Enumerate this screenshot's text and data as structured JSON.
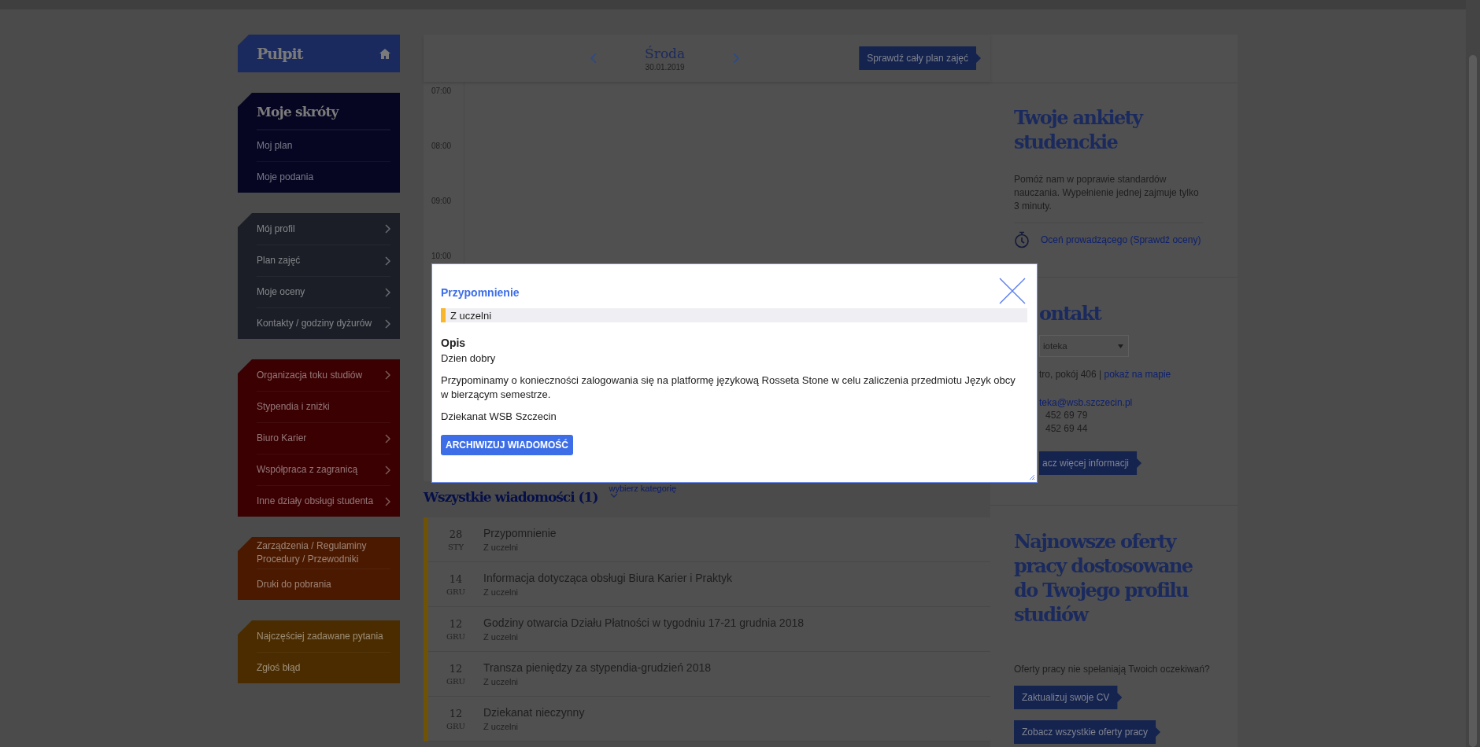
{
  "sidebar": {
    "home": {
      "label": "Pulpit"
    },
    "groups": [
      {
        "kind": "titled",
        "title": "Moje skróty",
        "color": "#060622",
        "items": [
          {
            "label": "Moj plan",
            "submenu": false
          },
          {
            "label": "Moje podania",
            "submenu": false
          }
        ]
      },
      {
        "kind": "plain",
        "color": "#1b1e26",
        "items": [
          {
            "label": "Mój profil",
            "submenu": true
          },
          {
            "label": "Plan zajęć",
            "submenu": true
          },
          {
            "label": "Moje oceny",
            "submenu": true
          },
          {
            "label": "Kontakty / godziny dyżurów",
            "submenu": true
          }
        ]
      },
      {
        "kind": "plain",
        "color": "#3a0002",
        "items": [
          {
            "label": "Organizacja toku studiów",
            "submenu": true
          },
          {
            "label": "Stypendia i zniżki",
            "submenu": false
          },
          {
            "label": "Biuro Karier",
            "submenu": true
          },
          {
            "label": "Współpraca z zagranicą",
            "submenu": true
          },
          {
            "label": "Inne działy obsługi studenta",
            "submenu": true
          }
        ]
      },
      {
        "kind": "plain",
        "color": "#4a1900",
        "items": [
          {
            "label": "Zarządzenia / Regulaminy Procedury / Przewodniki",
            "submenu": false
          },
          {
            "label": "Druki do pobrania",
            "submenu": false
          }
        ]
      },
      {
        "kind": "plain",
        "color": "#4a2c00",
        "items": [
          {
            "label": "Najczęściej zadawane pytania",
            "submenu": false
          },
          {
            "label": "Zgłoś błąd",
            "submenu": false
          }
        ]
      }
    ]
  },
  "calendar": {
    "day": "Środa",
    "date": "30.01.2019",
    "button": "Sprawdź cały plan zajęć",
    "hours": [
      "07:00",
      "08:00",
      "09:00",
      "10:00"
    ]
  },
  "messages": {
    "title": "Wszystkie wiadomości (1)",
    "filter": "wybierz kategorię",
    "items": [
      {
        "day": "28",
        "month": "STY",
        "title": "Przypomnienie",
        "category": "Z uczelni"
      },
      {
        "day": "14",
        "month": "GRU",
        "title": "Informacja dotycząca obsługi Biura Karier i Praktyk",
        "category": "Z uczelni"
      },
      {
        "day": "12",
        "month": "GRU",
        "title": "Godziny otwarcia Działu Płatności w tygodniu 17-21 grudnia 2018",
        "category": "Z uczelni"
      },
      {
        "day": "12",
        "month": "GRU",
        "title": "Transza pieniędzy za stypendia-grudzień 2018",
        "category": "Z uczelni"
      },
      {
        "day": "12",
        "month": "GRU",
        "title": "Dziekanat nieczynny",
        "category": "Z uczelni"
      }
    ]
  },
  "survey": {
    "title": "Twoje ankiety studenckie",
    "text": "Pomóż nam w poprawie standardów nauczania. Wypełnienie jednej zajmuje tylko 3 minuty.",
    "link": "Oceń prowadzącego (Sprawdź oceny)"
  },
  "contact": {
    "title": "ontakt",
    "select": "ioteka",
    "address": "tro, pokój 406 |",
    "map_link": "pokaż na mapie",
    "email": "teka@wsb.szczecin.pl",
    "phones": [
      "452 69 79",
      "452 69 44"
    ],
    "button": "acz więcej informacji"
  },
  "jobs": {
    "title": "Najnowsze oferty pracy dostosowane do Twojego profilu studiów",
    "text": "Oferty pracy nie spełaniają Twoich oczekiwań?",
    "buttons": [
      "Zaktualizuj swoje CV",
      "Zobacz wszystkie oferty pracy"
    ]
  },
  "modal": {
    "title": "Przypomnienie",
    "category": "Z uczelni",
    "section": "Opis",
    "paragraphs": [
      "Dzien dobry",
      "Przypominamy o konieczności zalogowania się na platformę językową  Rosseta Stone w celu zaliczenia przedmiotu Język obcy w bierzącym semestrze.",
      "Dziekanat WSB Szczecin"
    ],
    "button": "ARCHIWIZUJ WIADOMOŚĆ"
  }
}
